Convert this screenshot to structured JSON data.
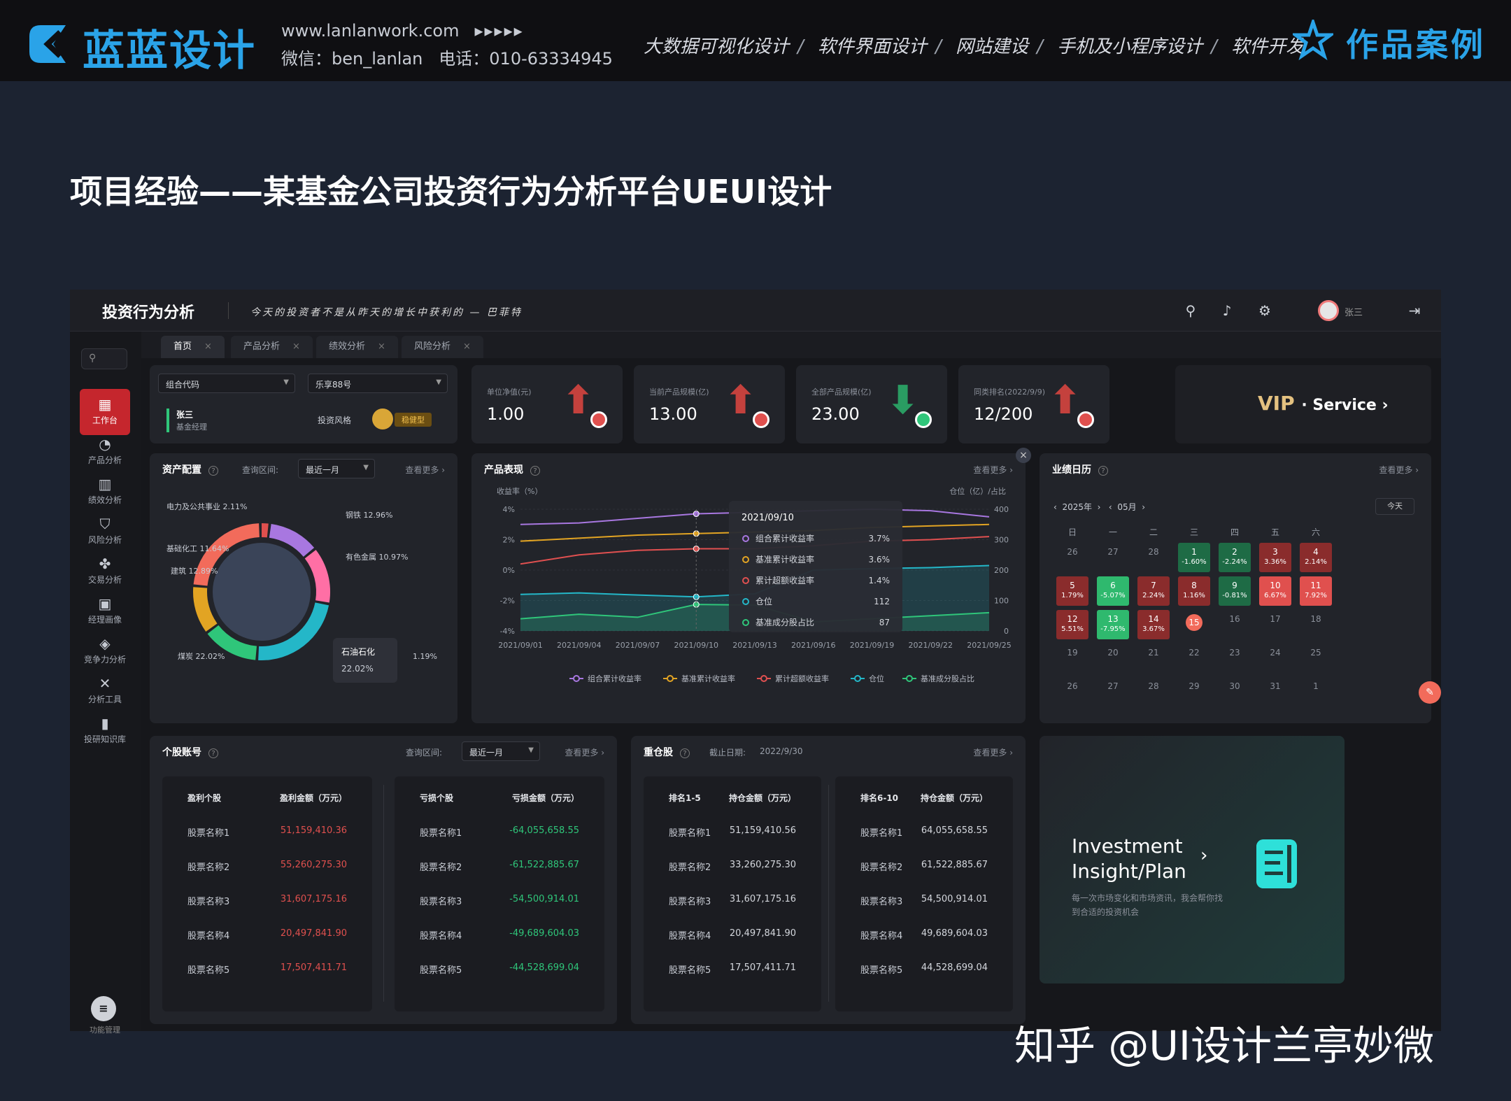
{
  "brand": {
    "name": "蓝蓝设计",
    "website": "www.lanlanwork.com",
    "arrows": "▸▸▸▸▸",
    "wechat": "微信：ben_lanlan",
    "phone": "电话：010-63334945",
    "services": [
      "大数据可视化设计",
      "软件界面设计",
      "网站建设",
      "手机及小程序设计",
      "软件开发"
    ],
    "works_label": "作品案例"
  },
  "page_title": "项目经验——某基金公司投资行为分析平台UEUI设计",
  "dashboard": {
    "title": "投资行为分析",
    "slogan": "今天的投资者不是从昨天的增长中获利的 — 巴菲特",
    "user": "张三",
    "sidebar": [
      {
        "label": "工作台",
        "icon": "grid-icon",
        "glyph": "▦",
        "active": true
      },
      {
        "label": "产品分析",
        "icon": "pie-icon",
        "glyph": "◔",
        "active": false
      },
      {
        "label": "绩效分析",
        "icon": "bar-chart-icon",
        "glyph": "▥",
        "active": false
      },
      {
        "label": "风险分析",
        "icon": "shield-icon",
        "glyph": "⛉",
        "active": false
      },
      {
        "label": "交易分析",
        "icon": "nodes-icon",
        "glyph": "✤",
        "active": false
      },
      {
        "label": "经理画像",
        "icon": "id-card-icon",
        "glyph": "▣",
        "active": false
      },
      {
        "label": "竞争力分析",
        "icon": "cube-icon",
        "glyph": "◈",
        "active": false
      },
      {
        "label": "分析工具",
        "icon": "tools-icon",
        "glyph": "✕",
        "active": false
      },
      {
        "label": "投研知识库",
        "icon": "books-icon",
        "glyph": "▮",
        "active": false
      }
    ],
    "sidebar_footer": "功能管理",
    "tabs": [
      {
        "label": "首页",
        "active": true
      },
      {
        "label": "产品分析",
        "active": false
      },
      {
        "label": "绩效分析",
        "active": false
      },
      {
        "label": "风险分析",
        "active": false
      }
    ],
    "filters": {
      "combo_code": "组合代码",
      "combo_value": "乐享88号",
      "manager_badge": "张三",
      "manager_role": "基金经理",
      "style_label": "投资风格",
      "style_value": "稳健型"
    },
    "kpis": [
      {
        "label": "单位净值(元)",
        "value": "1.00",
        "direction": "up"
      },
      {
        "label": "当前产品规模(亿)",
        "value": "13.00",
        "direction": "up"
      },
      {
        "label": "全部产品规模(亿)",
        "value": "23.00",
        "direction": "down"
      },
      {
        "label": "同类排名(2022/9/9)",
        "value": "12/200",
        "direction": "up"
      }
    ],
    "vip": {
      "brand": "VIP",
      "service": "· Service ›"
    },
    "asset": {
      "title": "资产配置",
      "range_label": "查询区间:",
      "range_value": "最近一月",
      "more": "查看更多 ›",
      "tooltip_name": "石油石化",
      "tooltip_value": "22.02%",
      "slice_labels": [
        {
          "name": "电力及公共事业",
          "pct": "2.11%"
        },
        {
          "name": "基础化工",
          "pct": "11.64%"
        },
        {
          "name": "建筑",
          "pct": "12.89%"
        },
        {
          "name": "煤炭",
          "pct": "22.02%"
        },
        {
          "name": "钢铁",
          "pct": "12.96%"
        },
        {
          "name": "有色金属",
          "pct": "10.97%"
        },
        {
          "name": "",
          "pct": "1.19%"
        }
      ]
    },
    "perf": {
      "title": "产品表现",
      "more": "查看更多 ›",
      "ylabel_left": "收益率（%）",
      "ylabel_right": "仓位（亿）/占比",
      "tooltip_date": "2021/09/10",
      "tooltip_rows": [
        {
          "name": "组合累计收益率",
          "value": "3.7%",
          "color": "#a877e0"
        },
        {
          "name": "基准累计收益率",
          "value": "3.6%",
          "color": "#e2a423"
        },
        {
          "name": "累计超额收益率",
          "value": "1.4%",
          "color": "#e05050"
        },
        {
          "name": "仓位",
          "value": "112",
          "color": "#24b7c8"
        },
        {
          "name": "基准成分股占比",
          "value": "87",
          "color": "#2fc67a"
        }
      ]
    },
    "calendar": {
      "title": "业绩日历",
      "more": "查看更多 ›",
      "year": "2025年",
      "month": "05月",
      "today": "今天",
      "weekdays": [
        "日",
        "一",
        "二",
        "三",
        "四",
        "五",
        "六"
      ],
      "cells": [
        {
          "d": "26",
          "p": "",
          "c": ""
        },
        {
          "d": "27",
          "p": "",
          "c": ""
        },
        {
          "d": "28",
          "p": "",
          "c": ""
        },
        {
          "d": "1",
          "p": "-1.60%",
          "c": "g"
        },
        {
          "d": "2",
          "p": "-2.24%",
          "c": "g"
        },
        {
          "d": "3",
          "p": "3.36%",
          "c": "r"
        },
        {
          "d": "4",
          "p": "2.14%",
          "c": "r"
        },
        {
          "d": "5",
          "p": "1.79%",
          "c": "r"
        },
        {
          "d": "6",
          "p": "-5.07%",
          "c": "G"
        },
        {
          "d": "7",
          "p": "2.24%",
          "c": "r"
        },
        {
          "d": "8",
          "p": "1.16%",
          "c": "r"
        },
        {
          "d": "9",
          "p": "-0.81%",
          "c": "g"
        },
        {
          "d": "10",
          "p": "6.67%",
          "c": "R"
        },
        {
          "d": "11",
          "p": "7.92%",
          "c": "R"
        },
        {
          "d": "12",
          "p": "5.51%",
          "c": "r"
        },
        {
          "d": "13",
          "p": "-7.95%",
          "c": "G"
        },
        {
          "d": "14",
          "p": "3.67%",
          "c": "r"
        },
        {
          "d": "15",
          "p": "",
          "c": "today"
        },
        {
          "d": "16",
          "p": "",
          "c": ""
        },
        {
          "d": "17",
          "p": "",
          "c": ""
        },
        {
          "d": "18",
          "p": "",
          "c": ""
        },
        {
          "d": "19",
          "p": "",
          "c": ""
        },
        {
          "d": "20",
          "p": "",
          "c": ""
        },
        {
          "d": "21",
          "p": "",
          "c": ""
        },
        {
          "d": "22",
          "p": "",
          "c": ""
        },
        {
          "d": "23",
          "p": "",
          "c": ""
        },
        {
          "d": "24",
          "p": "",
          "c": ""
        },
        {
          "d": "25",
          "p": "",
          "c": ""
        },
        {
          "d": "26",
          "p": "",
          "c": ""
        },
        {
          "d": "27",
          "p": "",
          "c": ""
        },
        {
          "d": "28",
          "p": "",
          "c": ""
        },
        {
          "d": "29",
          "p": "",
          "c": ""
        },
        {
          "d": "30",
          "p": "",
          "c": ""
        },
        {
          "d": "31",
          "p": "",
          "c": ""
        },
        {
          "d": "1",
          "p": "",
          "c": ""
        }
      ]
    },
    "stocks": {
      "title": "个股账号",
      "range_label": "查询区间:",
      "range_value": "最近一月",
      "more": "查看更多 ›",
      "profit": {
        "h1": "盈利个股",
        "h2": "盈利金额（万元）",
        "rows": [
          [
            "股票名称1",
            "51,159,410.36"
          ],
          [
            "股票名称2",
            "55,260,275.30"
          ],
          [
            "股票名称3",
            "31,607,175.16"
          ],
          [
            "股票名称4",
            "20,497,841.90"
          ],
          [
            "股票名称5",
            "17,507,411.71"
          ]
        ]
      },
      "loss": {
        "h1": "亏损个股",
        "h2": "亏损金额（万元）",
        "rows": [
          [
            "股票名称1",
            "-64,055,658.55"
          ],
          [
            "股票名称2",
            "-61,522,885.67"
          ],
          [
            "股票名称3",
            "-54,500,914.01"
          ],
          [
            "股票名称4",
            "-49,689,604.03"
          ],
          [
            "股票名称5",
            "-44,528,699.04"
          ]
        ]
      }
    },
    "holdings": {
      "title": "重仓股",
      "date_label": "截止日期:",
      "date_value": "2022/9/30",
      "more": "查看更多 ›",
      "top": {
        "h1": "排名1-5",
        "h2": "持仓金额（万元）",
        "rows": [
          [
            "股票名称1",
            "51,159,410.56"
          ],
          [
            "股票名称2",
            "33,260,275.30"
          ],
          [
            "股票名称3",
            "31,607,175.16"
          ],
          [
            "股票名称4",
            "20,497,841.90"
          ],
          [
            "股票名称5",
            "17,507,411.71"
          ]
        ]
      },
      "next": {
        "h1": "排名6-10",
        "h2": "持仓金额（万元）",
        "rows": [
          [
            "股票名称1",
            "64,055,658.55"
          ],
          [
            "股票名称2",
            "61,522,885.67"
          ],
          [
            "股票名称3",
            "54,500,914.01"
          ],
          [
            "股票名称4",
            "49,689,604.03"
          ],
          [
            "股票名称5",
            "44,528,699.04"
          ]
        ]
      }
    },
    "insight": {
      "title_line1": "Investment",
      "title_line2": "Insight/Plan",
      "desc": "每一次市场变化和市场资讯，我会帮你找到合适的投资机会"
    }
  },
  "watermark": "知乎 @UI设计兰亭妙微",
  "chart_data": [
    {
      "type": "pie",
      "title": "资产配置",
      "categories": [
        "电力及公共事业",
        "基础化工",
        "建筑",
        "煤炭",
        "钢铁",
        "有色金属",
        "石油石化"
      ],
      "values": [
        2.11,
        11.64,
        12.89,
        22.02,
        12.96,
        10.97,
        22.02
      ],
      "colors": [
        "#e0504e",
        "#a877e0",
        "#ff6fa5",
        "#24b7c8",
        "#2fc67a",
        "#e2a423",
        "#f26b5b"
      ]
    },
    {
      "type": "line",
      "title": "产品表现",
      "xlabel": "",
      "ylabel": "收益率（%）",
      "ylim": [
        -4,
        4
      ],
      "y2lim": [
        0,
        400
      ],
      "y_ticks": [
        "-4%",
        "-2%",
        "0%",
        "2%",
        "4%"
      ],
      "y2_ticks": [
        "0",
        "100",
        "200",
        "300",
        "400"
      ],
      "x": [
        "2021/09/01",
        "2021/09/04",
        "2021/09/07",
        "2021/09/10",
        "2021/09/13",
        "2021/09/16",
        "2021/09/19",
        "2021/09/22",
        "2021/09/25"
      ],
      "series": [
        {
          "name": "组合累计收益率",
          "axis": "left",
          "color": "#a877e0",
          "values": [
            3.0,
            3.1,
            3.4,
            3.7,
            3.8,
            3.9,
            4.0,
            3.9,
            3.5
          ]
        },
        {
          "name": "基准累计收益率",
          "axis": "left",
          "color": "#e2a423",
          "values": [
            1.9,
            2.1,
            2.3,
            2.4,
            2.5,
            2.6,
            2.8,
            2.9,
            3.0
          ]
        },
        {
          "name": "累计超额收益率",
          "axis": "left",
          "color": "#e05050",
          "values": [
            0.4,
            1.0,
            1.3,
            1.4,
            1.4,
            1.6,
            1.9,
            2.0,
            2.2
          ]
        },
        {
          "name": "仓位",
          "axis": "right",
          "color": "#24b7c8",
          "values": [
            120,
            125,
            118,
            112,
            122,
            200,
            205,
            208,
            215
          ]
        },
        {
          "name": "基准成分股占比",
          "axis": "right",
          "color": "#2fc67a",
          "values": [
            40,
            55,
            45,
            87,
            85,
            30,
            40,
            50,
            60
          ]
        }
      ]
    }
  ]
}
